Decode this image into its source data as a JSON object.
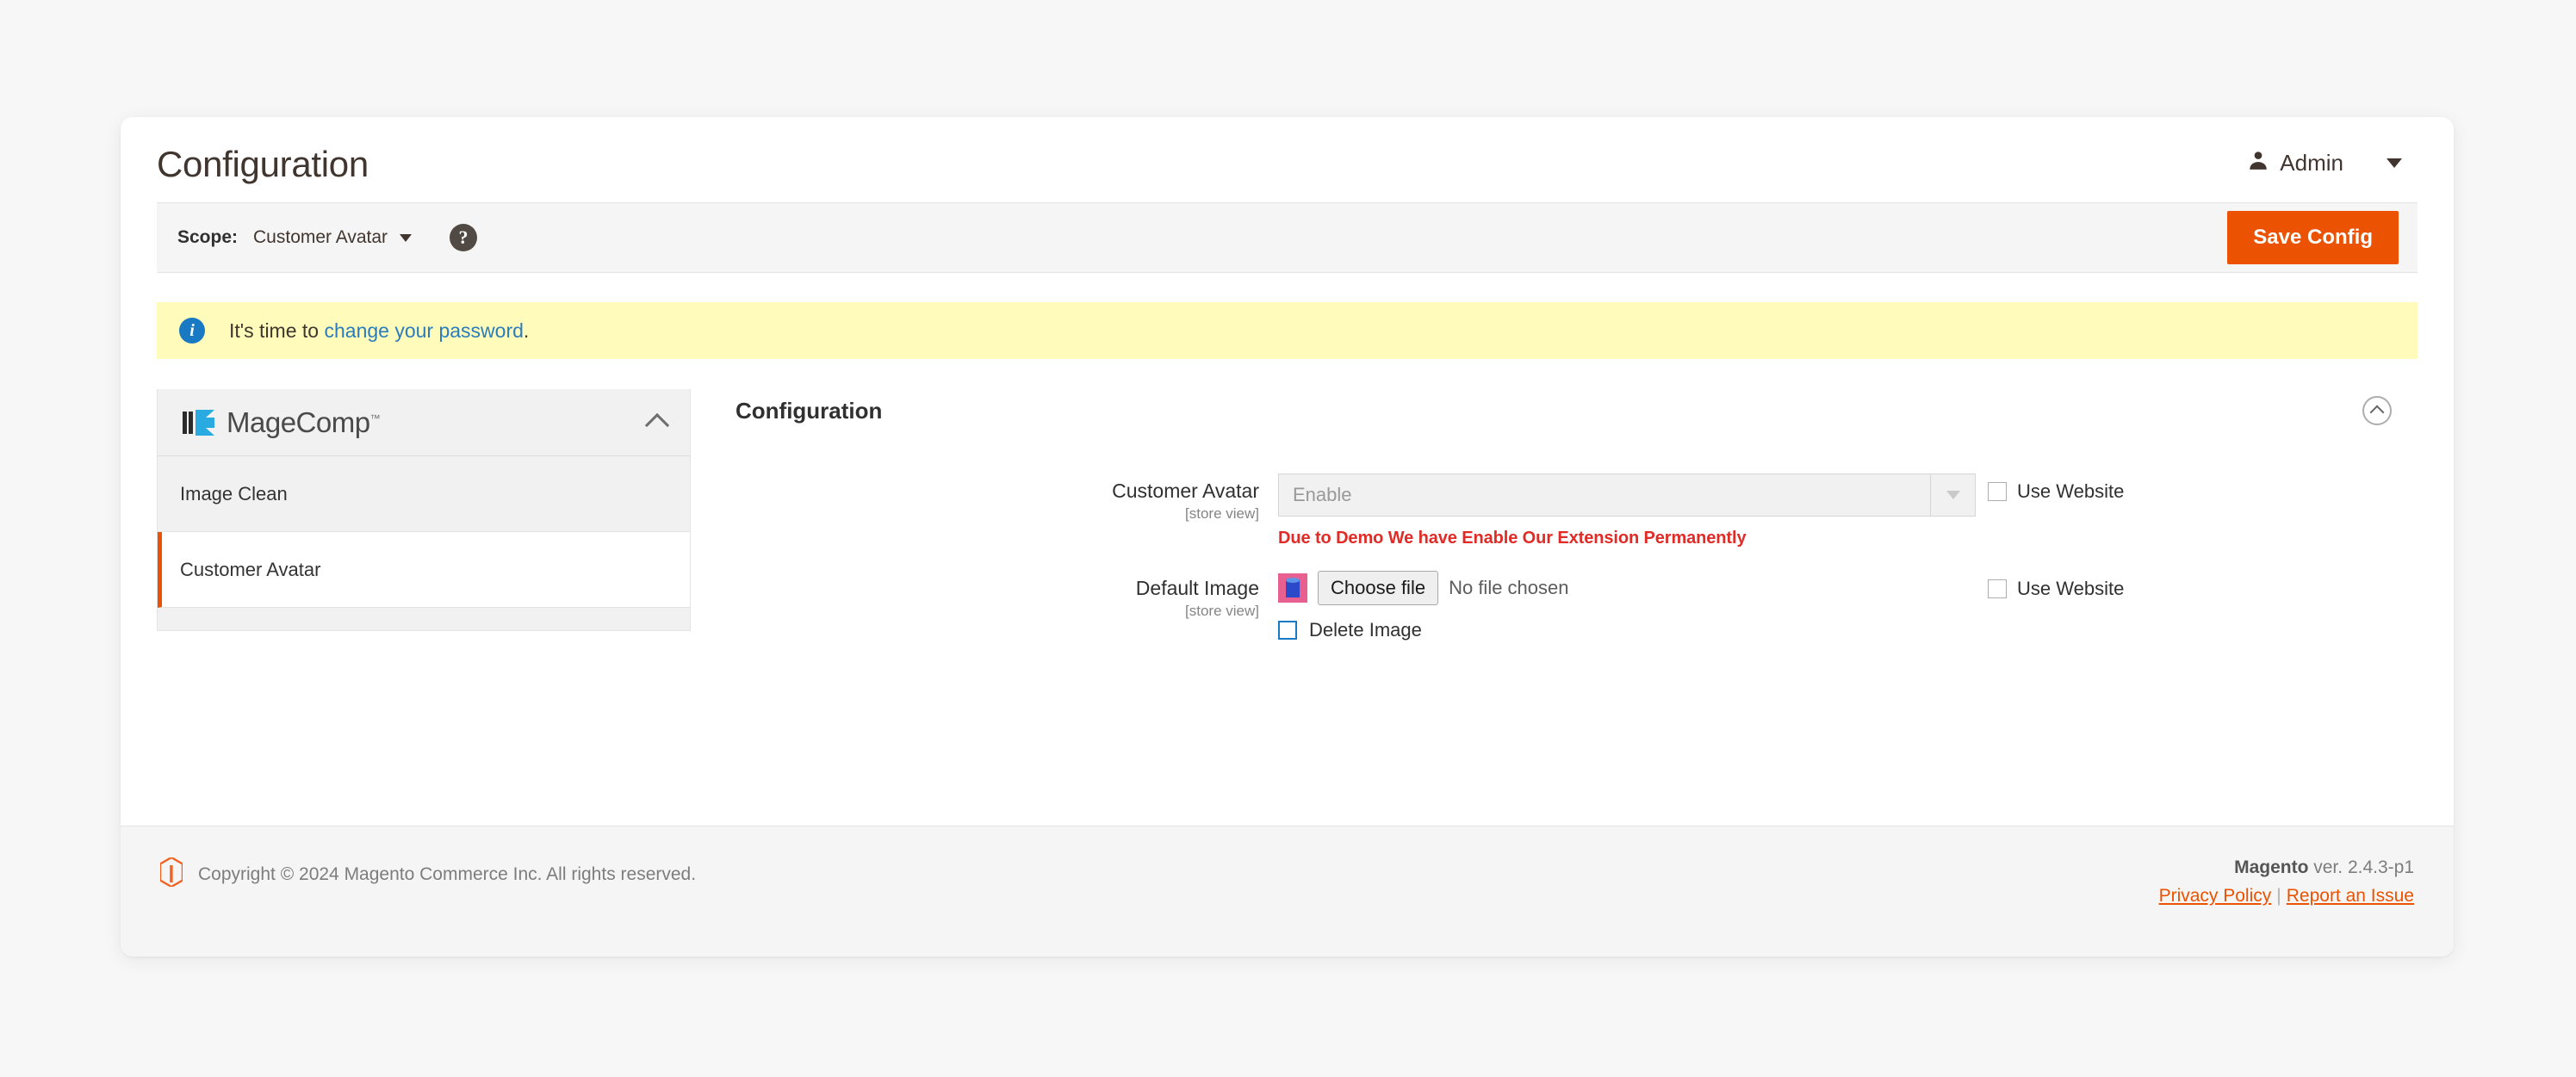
{
  "header": {
    "title": "Configuration",
    "admin_label": "Admin",
    "person_icon": "person-icon",
    "caret_icon": "chevron-down-icon"
  },
  "scope_bar": {
    "label": "Scope:",
    "value": "Customer Avatar",
    "help_icon": "question-mark-icon",
    "save_button": "Save Config"
  },
  "notice": {
    "icon": "info-icon",
    "prefix": "It's time to ",
    "link": "change your password",
    "suffix": "."
  },
  "sidebar": {
    "brand": "MageComp",
    "brand_tm": "™",
    "collapse_icon": "chevron-up-icon",
    "items": [
      {
        "label": "Image Clean",
        "active": false
      },
      {
        "label": "Customer Avatar",
        "active": true
      }
    ]
  },
  "main": {
    "section_title": "Configuration",
    "collapse_icon": "chevron-up-circle-icon",
    "fields": [
      {
        "label": "Customer Avatar",
        "scope_note": "[store view]",
        "type": "select",
        "value": "Enable",
        "disabled": true,
        "warning": "Due to Demo We have Enable Our Extension Permanently",
        "use_website_label": "Use Website",
        "use_website_checked": false
      },
      {
        "label": "Default Image",
        "scope_note": "[store view]",
        "type": "file",
        "thumbnail_icon": "avatar-thumbnail",
        "choose_button": "Choose file",
        "file_status": "No file chosen",
        "delete_label": "Delete Image",
        "delete_checked": false,
        "use_website_label": "Use Website",
        "use_website_checked": false
      }
    ]
  },
  "footer": {
    "logo_icon": "magento-logo-icon",
    "copyright": "Copyright © 2024 Magento Commerce Inc. All rights reserved.",
    "version_brand": "Magento",
    "version_text": " ver. 2.4.3-p1",
    "privacy_link": "Privacy Policy",
    "separator": "|",
    "report_link": "Report an Issue"
  },
  "colors": {
    "accent_orange": "#eb5202",
    "link_blue": "#2a7cbd",
    "warning_red": "#e02b27",
    "notice_bg": "#fffbbb"
  }
}
